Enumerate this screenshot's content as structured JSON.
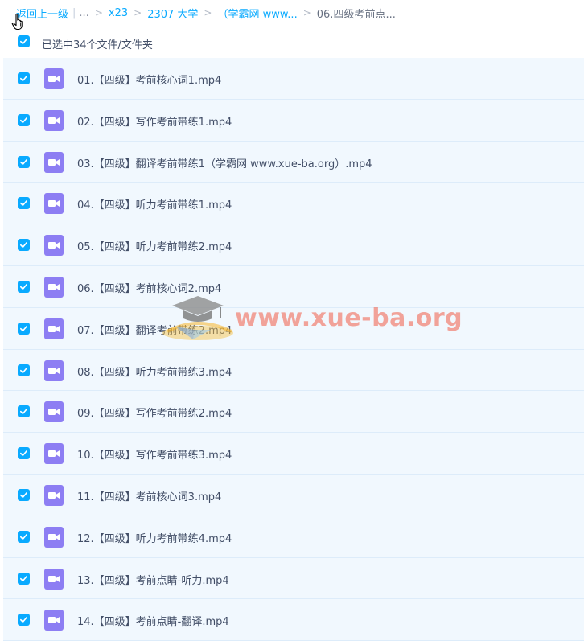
{
  "breadcrumb": {
    "back": "返回上一级",
    "ellipsis": "...",
    "sep": ">",
    "items": [
      "x23",
      "2307 大学",
      "（学霸网 www...",
      "06.四级考前点..."
    ]
  },
  "selection": {
    "label": "已选中34个文件/文件夹"
  },
  "files": [
    "01.【四级】考前核心词1.mp4",
    "02.【四级】写作考前带练1.mp4",
    "03.【四级】翻译考前带练1（学霸网 www.xue-ba.org）.mp4",
    "04.【四级】听力考前带练1.mp4",
    "05.【四级】听力考前带练2.mp4",
    "06.【四级】考前核心词2.mp4",
    "07.【四级】翻译考前带练2.mp4",
    "08.【四级】听力考前带练3.mp4",
    "09.【四级】写作考前带练2.mp4",
    "10.【四级】写作考前带练3.mp4",
    "11.【四级】考前核心词3.mp4",
    "12.【四级】听力考前带练4.mp4",
    "13.【四级】考前点睛-听力.mp4",
    "14.【四级】考前点睛-翻译.mp4"
  ],
  "watermark": {
    "text": "www.xue-ba.org"
  },
  "colors": {
    "accent": "#09aaff",
    "video_icon": "#8d7ef3",
    "row_bg": "#f1f8fe"
  }
}
